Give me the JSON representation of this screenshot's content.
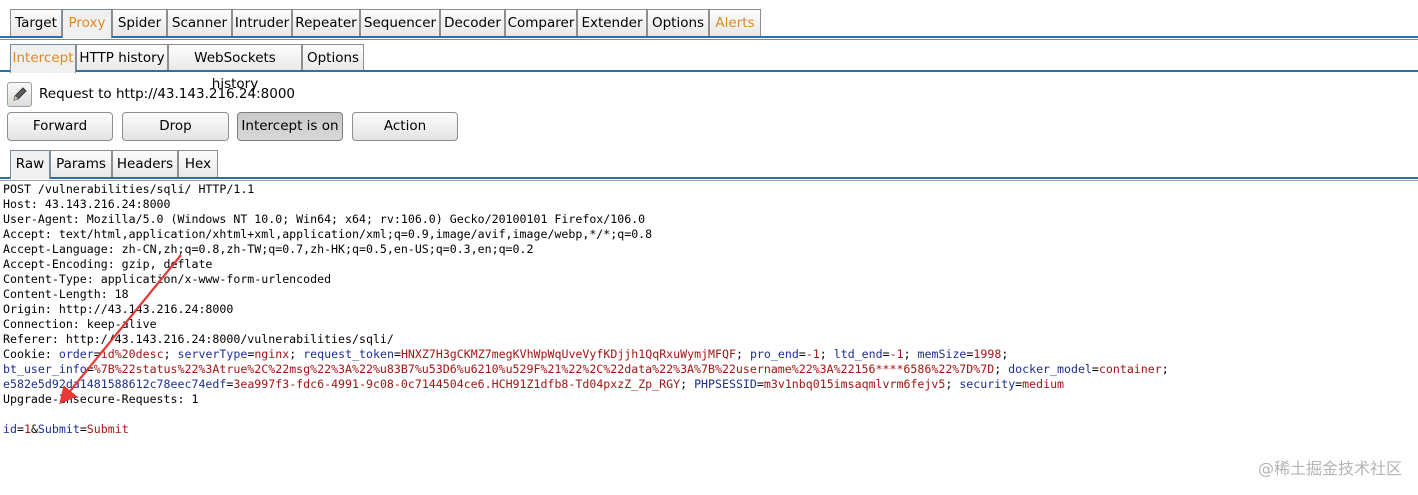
{
  "main_tabs": [
    "Target",
    "Proxy",
    "Spider",
    "Scanner",
    "Intruder",
    "Repeater",
    "Sequencer",
    "Decoder",
    "Comparer",
    "Extender",
    "Options",
    "Alerts"
  ],
  "sub_tabs": [
    "Intercept",
    "HTTP history",
    "WebSockets history",
    "Options"
  ],
  "status": "Request to http://43.143.216.24:8000",
  "buttons": [
    "Forward",
    "Drop",
    "Intercept is on",
    "Action"
  ],
  "view_tabs": [
    "Raw",
    "Params",
    "Headers",
    "Hex"
  ],
  "request": {
    "request_line": "POST /vulnerabilities/sqli/ HTTP/1.1",
    "host": "Host: 43.143.216.24:8000",
    "user_agent": "User-Agent: Mozilla/5.0 (Windows NT 10.0; Win64; x64; rv:106.0) Gecko/20100101 Firefox/106.0",
    "accept": "Accept: text/html,application/xhtml+xml,application/xml;q=0.9,image/avif,image/webp,*/*;q=0.8",
    "accept_language": "Accept-Language: zh-CN,zh;q=0.8,zh-TW;q=0.7,zh-HK;q=0.5,en-US;q=0.3,en;q=0.2",
    "accept_encoding": "Accept-Encoding: gzip, deflate",
    "content_type": "Content-Type: application/x-www-form-urlencoded",
    "content_length": "Content-Length: 18",
    "origin": "Origin: http://43.143.216.24:8000",
    "connection": "Connection: keep-alive",
    "referer": "Referer: http://43.143.216.24:8000/vulnerabilities/sqli/",
    "cookie_label": "Cookie: ",
    "cookie_1": [
      {
        "k": "order",
        "v": "id%20desc"
      },
      {
        "k": "serverType",
        "v": "nginx"
      },
      {
        "k": "request_token",
        "v": "HNXZ7H3gCKMZ7megKVhWpWqUveVyfKDjjh1QqRxuWymjMFQF"
      },
      {
        "k": "pro_end",
        "v": "-1"
      },
      {
        "k": "ltd_end",
        "v": "-1"
      },
      {
        "k": "memSize",
        "v": "1998"
      }
    ],
    "cookie_2": [
      {
        "k": "bt_user_info",
        "v": "%7B%22status%22%3Atrue%2C%22msg%22%3A%22%u83B7%u53D6%u6210%u529F%21%22%2C%22data%22%3A%7B%22username%22%3A%22156****6586%22%7D%7D"
      },
      {
        "k": "docker_model",
        "v": "container"
      }
    ],
    "cookie_3_prefix": "e582e5d92da1481588612c78eec74edf",
    "cookie_3_value": "3ea997f3-fdc6-4991-9c08-0c7144504ce6.HCH91Z1dfb8-Td04pxzZ_Zp_RGY",
    "cookie_3": [
      {
        "k": "PHPSESSID",
        "v": "m3v1nbq015imsaqmlvrm6fejv5"
      },
      {
        "k": "security",
        "v": "medium"
      }
    ],
    "upgrade": "Upgrade-Insecure-Requests: 1",
    "body": [
      {
        "k": "id",
        "v": "1"
      },
      {
        "k": "Submit",
        "v": "Submit"
      }
    ]
  },
  "watermark": "@稀土掘金技术社区",
  "colors": {
    "key": "#1c2f8f",
    "value": "#a31515",
    "tab_accent": "#e08a24",
    "rule": "#2f6fa8",
    "arrow": "#e53935"
  }
}
